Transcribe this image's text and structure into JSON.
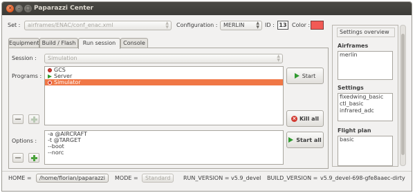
{
  "window": {
    "title": "Paparazzi Center"
  },
  "toolbar": {
    "set_label": "Set :",
    "set_value": "airframes/ENAC/conf_enac.xml",
    "configuration_label": "Configuration :",
    "configuration_value": "MERLIN",
    "id_label": "ID :",
    "id_value": "13",
    "color_label": "Color :",
    "color_value": "#f25a55"
  },
  "tabs": [
    {
      "label": "Equipment"
    },
    {
      "label": "Build / Flash"
    },
    {
      "label": "Run session"
    },
    {
      "label": "Console"
    }
  ],
  "active_tab": "Run session",
  "session": {
    "label": "Session :",
    "value": "Simulation"
  },
  "programs": {
    "label": "Programs :",
    "items": [
      {
        "label": "GCS",
        "status_icon": "stopped-icon"
      },
      {
        "label": "Server",
        "status_icon": "running-icon"
      },
      {
        "label": "Simulator",
        "status_icon": "stopped-icon",
        "selected": true
      }
    ],
    "start_label": "Start",
    "kill_all_label": "Kill all"
  },
  "options": {
    "label": "Options :",
    "items": [
      "-a @AIRCRAFT",
      "-t @TARGET",
      "--boot",
      "--norc"
    ],
    "start_all_label": "Start all"
  },
  "sidebar": {
    "title": "Settings overview",
    "airframes_heading": "Airframes",
    "airframes": [
      "merlin"
    ],
    "settings_heading": "Settings",
    "settings": [
      "fixedwing_basic",
      "ctl_basic",
      "infrared_adc"
    ],
    "flightplan_heading": "Flight plan",
    "flightplan": [
      "basic"
    ]
  },
  "statusbar": {
    "home_label": "HOME =",
    "home_value": "/home/florian/paparazzi",
    "mode_label": "MODE =",
    "mode_value": "Standard",
    "run_version_label": "RUN_VERSION =",
    "run_version_value": "v5.9_devel",
    "build_version_label": "BUILD_VERSION =",
    "build_version_value": "v5.9_devel-698-gfe8aaec-dirty"
  },
  "colors": {
    "accent": "#f07746",
    "play_green": "#2f9a2f",
    "stop_red": "#d23b32"
  }
}
